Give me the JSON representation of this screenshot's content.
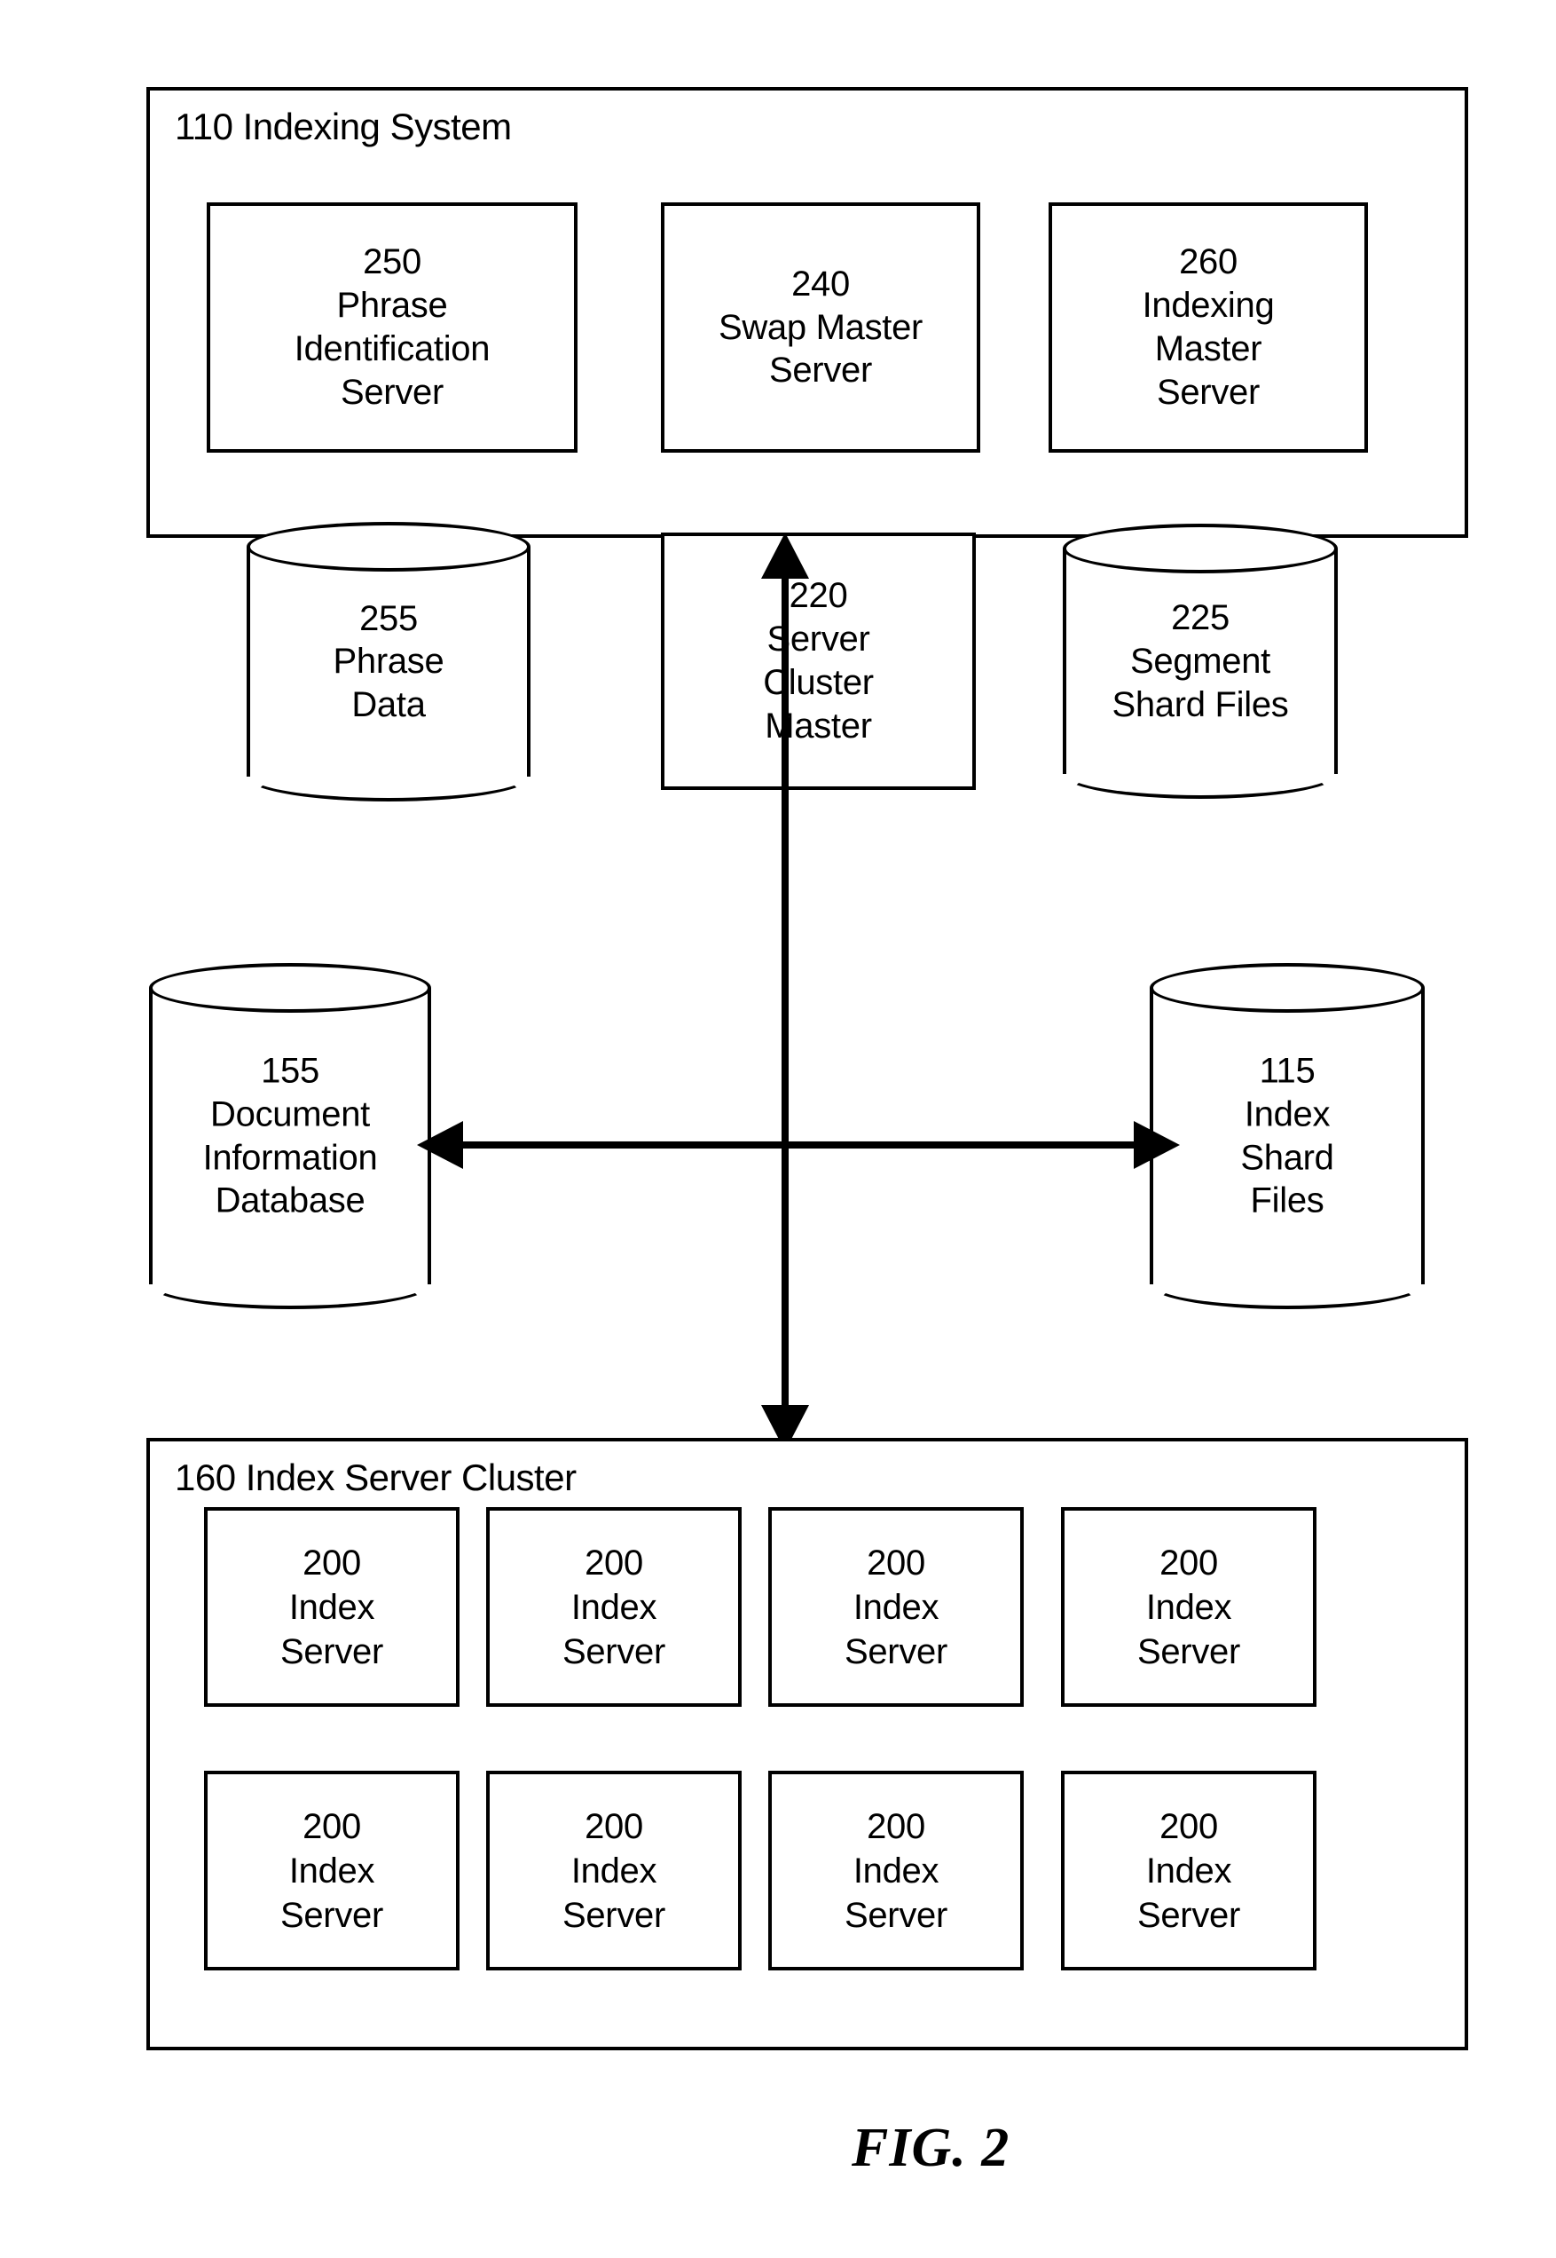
{
  "figure": {
    "caption": "FIG. 2"
  },
  "indexing_system": {
    "title": "110 Indexing System",
    "nodes": [
      {
        "id": "250",
        "shape": "rect",
        "lines": [
          "250",
          "Phrase",
          "Identification",
          "Server"
        ]
      },
      {
        "id": "240",
        "shape": "rect",
        "lines": [
          "240",
          "Swap Master",
          "Server"
        ]
      },
      {
        "id": "260",
        "shape": "rect",
        "lines": [
          "260",
          "Indexing",
          "Master",
          "Server"
        ]
      },
      {
        "id": "255",
        "shape": "cylinder",
        "lines": [
          "255",
          "Phrase",
          "Data"
        ]
      },
      {
        "id": "220",
        "shape": "rect",
        "lines": [
          "220",
          "Server",
          "Cluster",
          "Master"
        ]
      },
      {
        "id": "225",
        "shape": "cylinder",
        "lines": [
          "225",
          "Segment",
          "Shard Files"
        ]
      }
    ]
  },
  "datastores": {
    "document_information_database": {
      "id": "155",
      "shape": "cylinder",
      "lines": [
        "155",
        "Document",
        "Information",
        "Database"
      ]
    },
    "index_shard_files": {
      "id": "115",
      "shape": "cylinder",
      "lines": [
        "115",
        "Index",
        "Shard",
        "Files"
      ]
    }
  },
  "index_server_cluster": {
    "title": "160 Index Server Cluster",
    "servers": [
      {
        "lines": [
          "200",
          "Index",
          "Server"
        ]
      },
      {
        "lines": [
          "200",
          "Index",
          "Server"
        ]
      },
      {
        "lines": [
          "200",
          "Index",
          "Server"
        ]
      },
      {
        "lines": [
          "200",
          "Index",
          "Server"
        ]
      },
      {
        "lines": [
          "200",
          "Index",
          "Server"
        ]
      },
      {
        "lines": [
          "200",
          "Index",
          "Server"
        ]
      },
      {
        "lines": [
          "200",
          "Index",
          "Server"
        ]
      },
      {
        "lines": [
          "200",
          "Index",
          "Server"
        ]
      }
    ]
  },
  "connectors": [
    {
      "name": "vertical-bidirectional-arrow",
      "from": "110 Indexing System",
      "to": "160 Index Server Cluster",
      "style": "double-headed"
    },
    {
      "name": "horizontal-bidirectional-arrow",
      "from": "155 Document Information Database",
      "to": "115 Index Shard Files",
      "style": "double-headed"
    }
  ],
  "colors": {
    "stroke": "#000000",
    "background": "#ffffff"
  }
}
